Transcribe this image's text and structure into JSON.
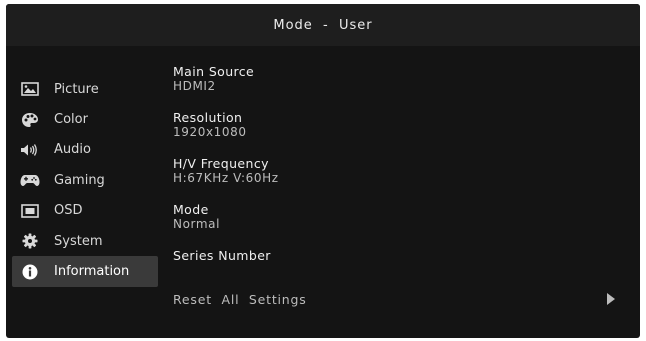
{
  "header": {
    "title": "Mode  -  User"
  },
  "sidebar": {
    "items": [
      {
        "label": "Picture",
        "icon": "picture-icon",
        "active": false
      },
      {
        "label": "Color",
        "icon": "palette-icon",
        "active": false
      },
      {
        "label": "Audio",
        "icon": "speaker-icon",
        "active": false
      },
      {
        "label": "Gaming",
        "icon": "gamepad-icon",
        "active": false
      },
      {
        "label": "OSD",
        "icon": "osd-window-icon",
        "active": false
      },
      {
        "label": "System",
        "icon": "gear-icon",
        "active": false
      },
      {
        "label": "Information",
        "icon": "info-icon",
        "active": true
      }
    ]
  },
  "info": {
    "main_source": {
      "label": "Main  Source",
      "value": "HDMI2"
    },
    "resolution": {
      "label": "Resolution",
      "value": "1920x1080"
    },
    "frequency": {
      "label": "H/V  Frequency",
      "value": "H:67KHz  V:60Hz"
    },
    "mode": {
      "label": "Mode",
      "value": "Normal"
    },
    "series_number": {
      "label": "Series  Number",
      "value": ""
    }
  },
  "reset": {
    "label": "Reset  All  Settings",
    "icon": "arrow-right-icon"
  },
  "colors": {
    "background": "#141414",
    "header": "#1e1e1e",
    "active_item": "#3a3a3a",
    "text": "#e2e2e2"
  }
}
